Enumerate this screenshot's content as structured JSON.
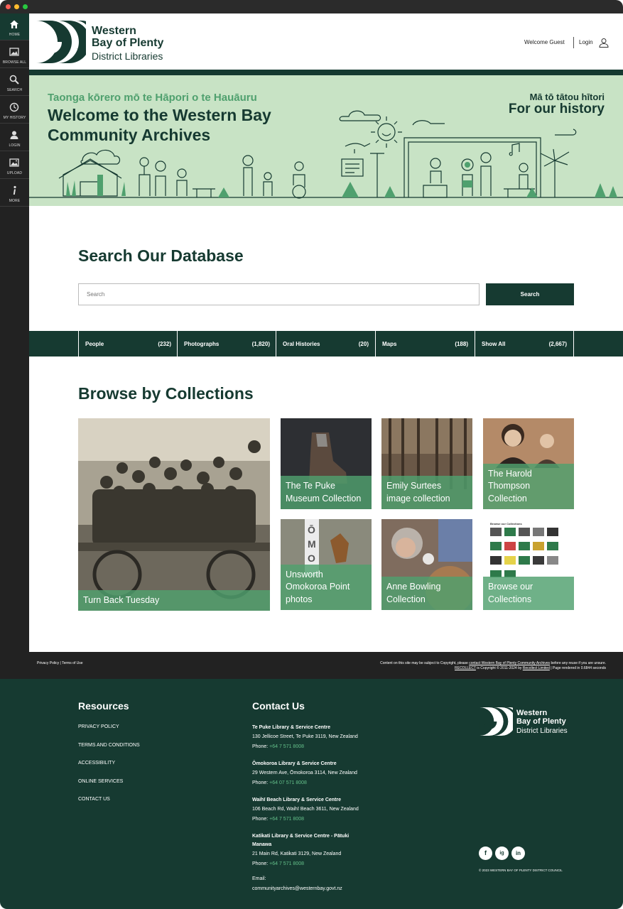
{
  "sidebar": {
    "items": [
      {
        "label": "HOME",
        "icon": "home-icon"
      },
      {
        "label": "BROWSE ALL",
        "icon": "image-icon"
      },
      {
        "label": "SEARCH",
        "icon": "search-icon"
      },
      {
        "label": "MY HISTORY",
        "icon": "clock-icon"
      },
      {
        "label": "LOGIN",
        "icon": "user-icon"
      },
      {
        "label": "UPLOAD",
        "icon": "upload-image-icon"
      },
      {
        "label": "MORE",
        "icon": "info-icon"
      }
    ]
  },
  "header": {
    "logo_line1": "Western",
    "logo_line2": "Bay of Plenty",
    "logo_line3": "District Libraries",
    "welcome": "Welcome Guest",
    "login": "Login"
  },
  "hero": {
    "subtitle": "Taonga kōrero mō te Hāpori o te Hauāuru",
    "title": "Welcome to the Western Bay Community Archives",
    "right_line1": "Mā tō tātou hītori",
    "right_line2": "For our history"
  },
  "search": {
    "title": "Search Our Database",
    "placeholder": "Search",
    "button": "Search"
  },
  "categories": [
    {
      "name": "People",
      "count": "(232)"
    },
    {
      "name": "Photographs",
      "count": "(1,820)"
    },
    {
      "name": "Oral Histories",
      "count": "(20)"
    },
    {
      "name": "Maps",
      "count": "(188)"
    },
    {
      "name": "Show All",
      "count": "(2,667)"
    }
  ],
  "collections": {
    "title": "Browse by Collections",
    "items": [
      {
        "caption": "Turn Back Tuesday"
      },
      {
        "caption": "The Te Puke Museum Collection"
      },
      {
        "caption": "Emily Surtees image collection"
      },
      {
        "caption": "The Harold Thompson Collection"
      },
      {
        "caption": "Unsworth Omokoroa Point photos"
      },
      {
        "caption": "Anne Bowling Collection"
      },
      {
        "caption": "Browse our Collections"
      }
    ],
    "thumb_heading": "Browse our Collections"
  },
  "footbar": {
    "links": "Privacy Policy | Terms of Use",
    "copyright_line1_a": "Content on this site may be subject to Copyright, please ",
    "copyright_line1_link": "contact Western Bay of Plenty Community Archives",
    "copyright_line1_b": " before any reuse if you are unsure.",
    "copyright_line2_a": "RECOLLECT",
    "copyright_line2_b": " is Copyright © 2011-2024 by ",
    "copyright_line2_link": "Recollect Limited",
    "copyright_line2_c": " | Page rendered in 0.6844 seconds"
  },
  "footer": {
    "resources_title": "Resources",
    "resources": [
      "PRIVACY POLICY",
      "TERMS AND CONDITIONS",
      "ACCESSIBILITY",
      "ONLINE SERVICES",
      "CONTACT US"
    ],
    "contact_title": "Contact Us",
    "branches": [
      {
        "name": "Te Puke Library & Service Centre",
        "address": "130 Jellicoe Street, Te Puke 3119, New Zealand",
        "phone_label": "Phone: ",
        "phone": "+64 7 571 8008"
      },
      {
        "name": "Ōmokoroa Library & Service Centre",
        "address": "29 Western Ave, Ōmokoroa 3114, New Zealand",
        "phone_label": "Phone: ",
        "phone": "+64 07 571 8008"
      },
      {
        "name": "Waihī Beach Library & Service Centre",
        "address": "106 Beach Rd, Waihī Beach 3611, New Zealand",
        "phone_label": "Phone: ",
        "phone": "+64 7 571 8008"
      },
      {
        "name": "Katikati Library & Service Centre - Pātuki Manawa",
        "address": "21 Main Rd, Katikati 3129, New Zealand",
        "phone_label": "Phone: ",
        "phone": "+64 7 571 8008"
      }
    ],
    "email_label": "Email:",
    "email": "communityarchives@westernbay.govt.nz",
    "social": [
      "f",
      "ig",
      "in"
    ],
    "council": "© 2023 WESTERN BAY OF PLENTY DISTRICT COUNCIL"
  },
  "colors": {
    "brand": "#163a31",
    "accent": "#4fa06e",
    "hero_bg": "#c8e3c5"
  }
}
